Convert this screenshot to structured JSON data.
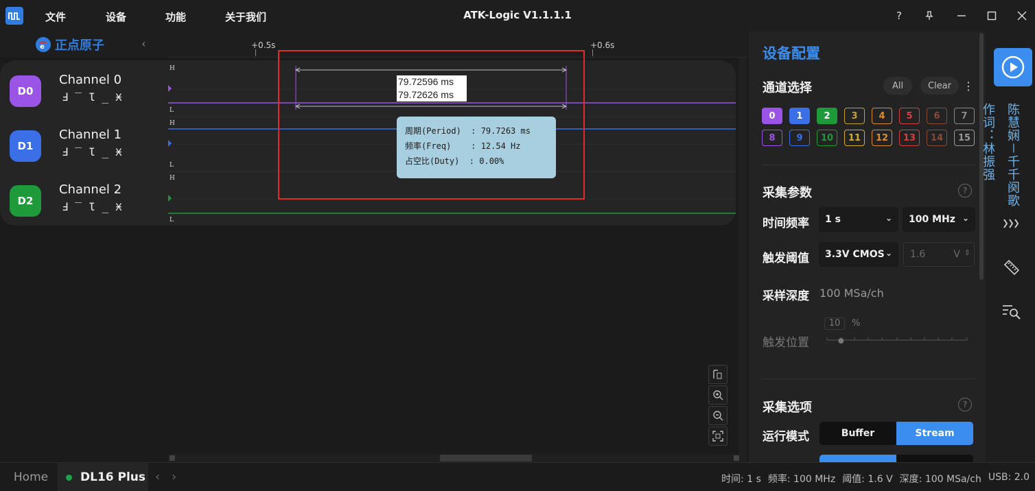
{
  "window": {
    "title": "ATK-Logic  V1.1.1.1",
    "controls": [
      "?",
      "pin",
      "minimize",
      "maximize",
      "close"
    ]
  },
  "menu": [
    "文件",
    "设备",
    "功能",
    "关于我们"
  ],
  "logo": {
    "text": "正点原子"
  },
  "ruler": {
    "ticks": [
      "+0.5s",
      "+0.6s"
    ]
  },
  "channels": [
    {
      "badge": "D0",
      "name": "Channel 0",
      "color": "#9a55e6"
    },
    {
      "badge": "D1",
      "name": "Channel 1",
      "color": "#3a6fe8"
    },
    {
      "badge": "D2",
      "name": "Channel 2",
      "color": "#1f9a3a"
    }
  ],
  "trigger_symbols": [
    "Ⅎ",
    "‾",
    "Ɩ",
    "_",
    "Ӿ"
  ],
  "level_labels": {
    "high": "H",
    "low": "L"
  },
  "measure": {
    "line1": "79.72596 ms",
    "line2": "79.72626 ms"
  },
  "tooltip": {
    "period_label": "周期(Period)  : 79.7263 ms",
    "freq_label": "频率(Freq)    : 12.54 Hz",
    "duty_label": "占空比(Duty)  : 0.00%"
  },
  "right_panel": {
    "title": "设备配置",
    "channel_select": {
      "label": "通道选择",
      "all": "All",
      "clear": "Clear",
      "more": "⋮"
    },
    "channel_boxes": [
      {
        "num": "0",
        "color": "#9a55e6",
        "active": true
      },
      {
        "num": "1",
        "color": "#3a6fe8",
        "active": true
      },
      {
        "num": "2",
        "color": "#1f9a3a",
        "active": true
      },
      {
        "num": "3",
        "color": "#c8a12a",
        "active": false
      },
      {
        "num": "4",
        "color": "#e08a2a",
        "active": false
      },
      {
        "num": "5",
        "color": "#d93f3f",
        "active": false
      },
      {
        "num": "6",
        "color": "#8a4a3a",
        "active": false
      },
      {
        "num": "7",
        "color": "#8a8a8a",
        "active": false
      },
      {
        "num": "8",
        "color": "#9a55e6",
        "active": false
      },
      {
        "num": "9",
        "color": "#3a6fe8",
        "active": false
      },
      {
        "num": "10",
        "color": "#1f9a3a",
        "active": false
      },
      {
        "num": "11",
        "color": "#d4b02a",
        "active": false
      },
      {
        "num": "12",
        "color": "#e08a2a",
        "active": false
      },
      {
        "num": "13",
        "color": "#d93f3f",
        "active": false
      },
      {
        "num": "14",
        "color": "#8a4a3a",
        "active": false
      },
      {
        "num": "15",
        "color": "#9a9a9a",
        "active": false
      }
    ],
    "sampling": {
      "label": "采集参数",
      "time_freq_label": "时间频率",
      "time_value": "1 s",
      "freq_value": "100 MHz",
      "threshold_label": "触发阈值",
      "threshold_value": "3.3V CMOS",
      "threshold_voltage": "1.6",
      "threshold_unit": "V",
      "depth_label": "采样深度",
      "depth_value": "100 MSa/ch",
      "trigger_pos_label": "触发位置",
      "trigger_pos_value": "10",
      "trigger_pos_unit": "%",
      "trigger_pos_fraction": 0.1
    },
    "options": {
      "label": "采集选项",
      "run_mode_label": "运行模式",
      "buffer": "Buffer",
      "stream": "Stream",
      "selected": "Stream"
    }
  },
  "lyrics": {
    "col1": "作词：林振强",
    "col2": "陈慧娴－千千阕歌"
  },
  "status": {
    "home_tab": "Home",
    "device_tab": "DL16 Plus",
    "time": "时间: 1 s",
    "freq": "频率: 100 MHz",
    "threshold": "阈值: 1.6 V",
    "depth": "深度: 100 MSa/ch",
    "usb": "USB: 2.0"
  },
  "colors": {
    "accent": "#3b8ef0",
    "highlight": "#e22b2b",
    "tooltip_bg": "#a7cfe0"
  }
}
